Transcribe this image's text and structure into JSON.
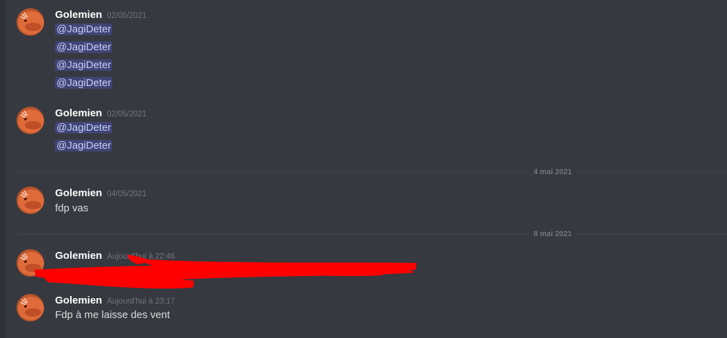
{
  "groups": [
    {
      "author": "Golemien",
      "timestamp": "02/05/2021",
      "lines": [
        "@JagiDeter",
        "@JagiDeter",
        "@JagiDeter",
        "@JagiDeter"
      ]
    },
    {
      "author": "Golemien",
      "timestamp": "02/05/2021",
      "lines": [
        "@JagiDeter",
        "@JagiDeter"
      ]
    },
    {
      "author": "Golemien",
      "timestamp": "04/05/2021",
      "lines": [
        "fdp vas"
      ]
    },
    {
      "author": "Golemien",
      "timestamp": "Aujourd'hui à 22:46",
      "lines": [
        ""
      ]
    },
    {
      "author": "Golemien",
      "timestamp": "Aujourd'hui à 23:17",
      "lines": [
        "Fdp à me laisse des vent"
      ]
    }
  ],
  "dividers": [
    "4 mai 2021",
    "8 mai 2021"
  ],
  "colors": {
    "background": "#36393f",
    "mention_bg": "#414675",
    "mention_text": "#c9cdfb",
    "redaction": "#ff0000",
    "avatar_skin": "#e06b3a"
  },
  "icons": [
    "avatar-image"
  ]
}
